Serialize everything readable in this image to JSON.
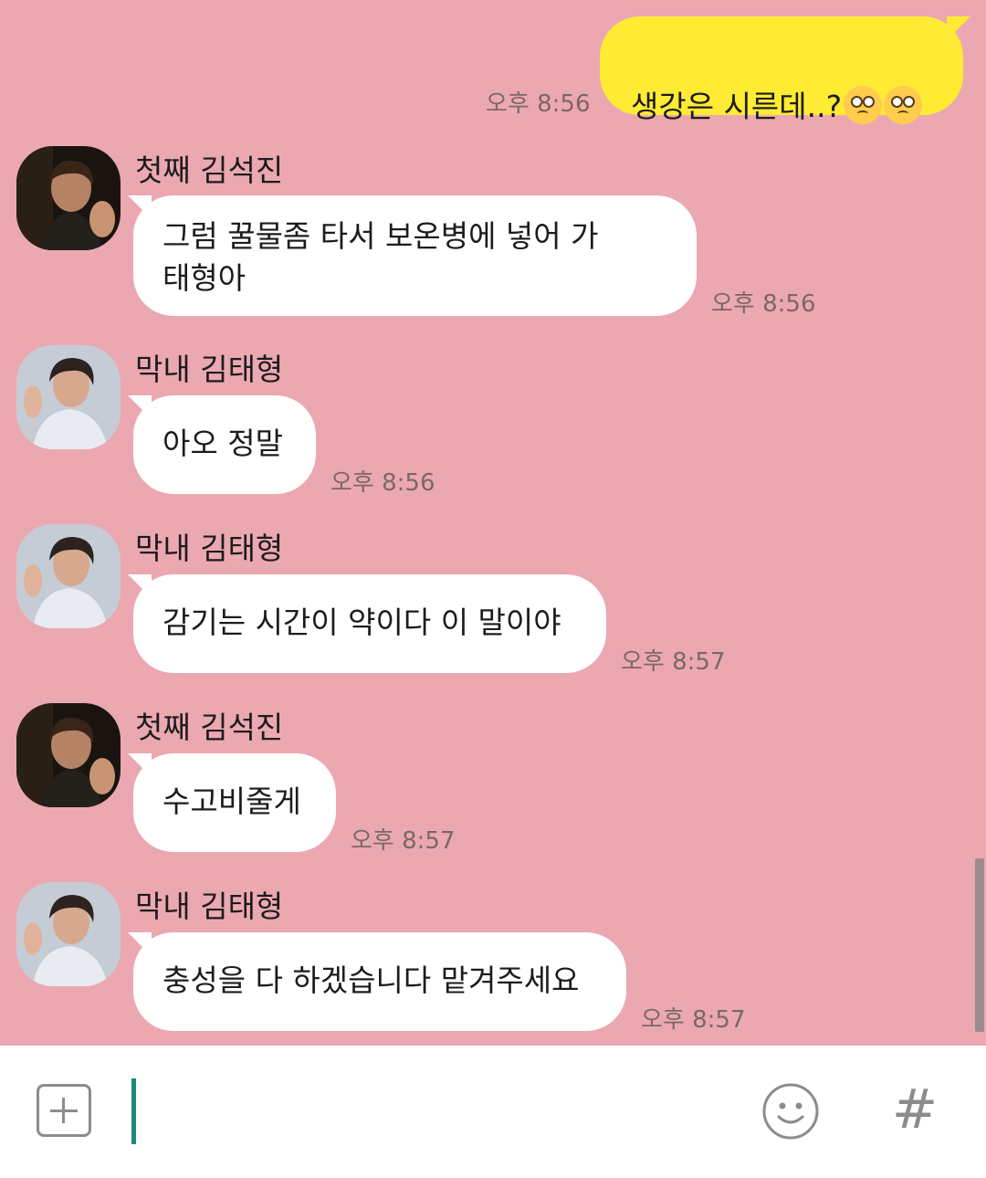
{
  "messages": [
    {
      "type": "me",
      "text": "생강은 시른데..?",
      "emoji_count": 2,
      "emoji_name": "pleading-face",
      "time": "오후 8:56"
    },
    {
      "type": "other",
      "sender": "첫째 김석진",
      "avatar": "seokjin",
      "text": "그럼 꿀물좀 타서 보온병에 넣어 가\n태형아",
      "time": "오후 8:56"
    },
    {
      "type": "other",
      "sender": "막내 김태형",
      "avatar": "taehyung",
      "text": "아오 정말",
      "time": "오후 8:56"
    },
    {
      "type": "other",
      "sender": "막내 김태형",
      "avatar": "taehyung",
      "text": "감기는 시간이 약이다 이 말이야",
      "time": "오후 8:57"
    },
    {
      "type": "other",
      "sender": "첫째 김석진",
      "avatar": "seokjin",
      "text": "수고비줄게",
      "time": "오후 8:57"
    },
    {
      "type": "other",
      "sender": "막내 김태형",
      "avatar": "taehyung",
      "text": "충성을 다 하겠습니다 맡겨주세요",
      "time": "오후 8:57"
    }
  ],
  "input_bar": {
    "plus_icon": "plus-icon",
    "emoji_icon": "smile-icon",
    "hash_label": "#",
    "placeholder": ""
  },
  "colors": {
    "chat_background": "#eca8b1",
    "my_bubble": "#ffeb33",
    "other_bubble": "#ffffff",
    "cursor": "#1f8a7a"
  }
}
